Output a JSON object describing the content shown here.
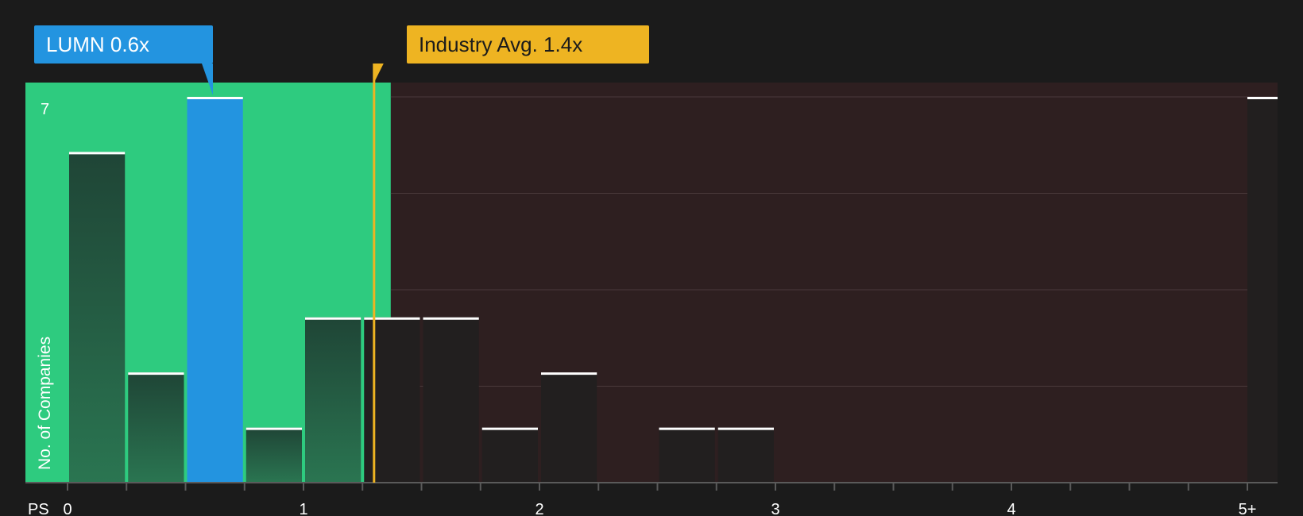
{
  "chart_data": {
    "type": "bar",
    "xlabel": "PS",
    "ylabel": "No. of Companies",
    "x_ticks": [
      "0",
      "1",
      "2",
      "3",
      "4",
      "5+"
    ],
    "y_max_label": "7",
    "ylim": [
      0,
      7
    ],
    "bin_width": 0.25,
    "bins": [
      {
        "start": 0.0,
        "count": 6
      },
      {
        "start": 0.25,
        "count": 2
      },
      {
        "start": 0.5,
        "count": 7,
        "highlight": true
      },
      {
        "start": 0.75,
        "count": 1
      },
      {
        "start": 1.0,
        "count": 3
      },
      {
        "start": 1.25,
        "count": 3
      },
      {
        "start": 1.5,
        "count": 3
      },
      {
        "start": 1.75,
        "count": 1
      },
      {
        "start": 2.0,
        "count": 2
      },
      {
        "start": 2.5,
        "count": 1
      },
      {
        "start": 2.75,
        "count": 1
      },
      {
        "start": 5.0,
        "count": 7
      }
    ],
    "company": {
      "ticker": "LUMN",
      "value": 0.6,
      "label": "LUMN 0.6x"
    },
    "industry": {
      "value": 1.4,
      "label": "Industry Avg. 1.4x"
    },
    "colors": {
      "background": "#1b1b1b",
      "undervalued_zone": "#2ecb7f",
      "overvalued_zone": "#2e1f20",
      "company": "#2394e0",
      "industry": "#eeb422",
      "bar_in_zone": "#22483a",
      "bar_out_zone": "#221f1f"
    }
  }
}
